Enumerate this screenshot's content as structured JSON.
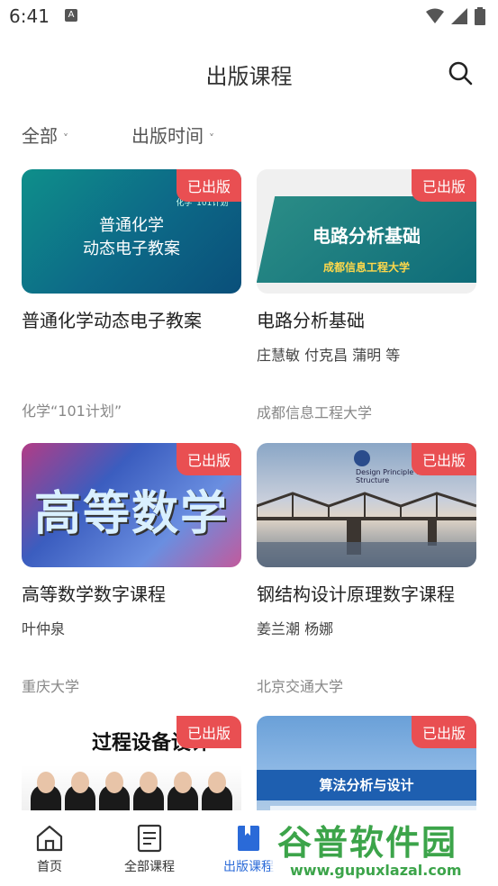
{
  "status": {
    "time": "6:41",
    "notif_glyph": "A"
  },
  "header": {
    "title": "出版课程",
    "search_icon": "search-icon"
  },
  "filters": [
    {
      "label": "全部"
    },
    {
      "label": "出版时间"
    }
  ],
  "badge_text": "已出版",
  "courses": [
    {
      "cover_line1": "普通化学",
      "cover_line2": "动态电子教案",
      "cover_tag": "化学“101计划”",
      "title": "普通化学动态电子教案",
      "authors": "",
      "org": "化学“101计划”"
    },
    {
      "cover_line1": "电路分析基础",
      "cover_line2": "成都信息工程大学",
      "title": "电路分析基础",
      "authors": "庄慧敏 付克昌 蒲明 等",
      "org": "成都信息工程大学"
    },
    {
      "cover_line1": "高等数学",
      "title": "高等数学数字课程",
      "authors": "叶仲泉",
      "org": "重庆大学"
    },
    {
      "cover_line1": "Design Principle of Steel Structure",
      "title": "钢结构设计原理数字课程",
      "authors": "姜兰潮 杨娜",
      "org": "北京交通大学"
    },
    {
      "cover_line1": "过程设备设计"
    },
    {
      "cover_line1": "算法分析与设计"
    }
  ],
  "nav": [
    {
      "label": "首页",
      "icon": "home-icon"
    },
    {
      "label": "全部课程",
      "icon": "document-icon"
    },
    {
      "label": "出版课程",
      "icon": "bookmark-icon"
    }
  ],
  "watermark": {
    "main": "谷普软件园",
    "url": "www.gupuxlazal.com"
  },
  "colors": {
    "badge": "#e94f52",
    "active": "#2a6ad8"
  }
}
